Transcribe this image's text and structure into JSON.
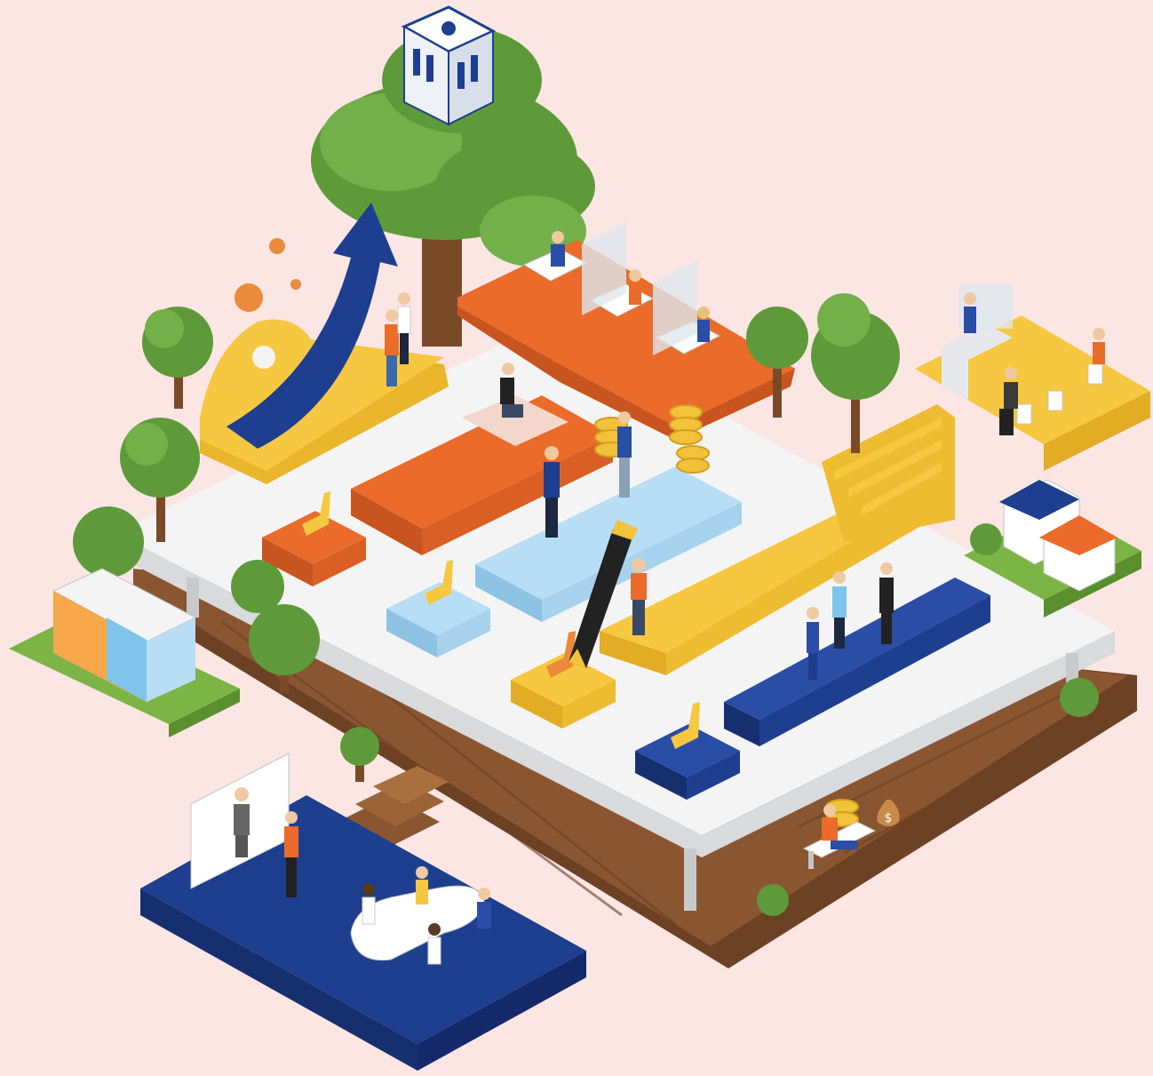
{
  "scene": {
    "title": "",
    "colors": {
      "background": "#fbe6e4",
      "platform_white": "#f4f4f4",
      "platform_side": "#d9dadb",
      "wood": "#8a5632",
      "wood_dark": "#6d4124",
      "orange": "#ea6b2a",
      "yellow": "#f6c741",
      "light_blue": "#b8def5",
      "navy": "#1e3f8f",
      "tree_green": "#5e9a3a",
      "grass": "#7cb446",
      "coin": "#f2c23a"
    },
    "icons": [
      "bank-building-icon",
      "growth-arrow-icon",
      "virus-icon",
      "fountain-pen-icon",
      "coin-stack-icon",
      "money-bag-icon",
      "house-icon",
      "shop-icon",
      "tree-icon",
      "staircase-icon"
    ],
    "money_bag_symbol": "$"
  }
}
